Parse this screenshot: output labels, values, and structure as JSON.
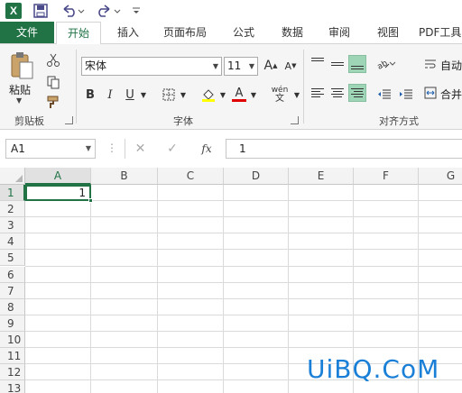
{
  "quick_access": {
    "excel_logo": "X"
  },
  "tabs": [
    "文件",
    "开始",
    "插入",
    "页面布局",
    "公式",
    "数据",
    "审阅",
    "视图",
    "PDF工具"
  ],
  "ribbon": {
    "clipboard": {
      "paste_label": "粘贴",
      "group_label": "剪贴板"
    },
    "font": {
      "font_name": "宋体",
      "font_size": "11",
      "group_label": "字体",
      "bold": "B",
      "italic": "I",
      "underline": "U",
      "grow": "A",
      "shrink": "A",
      "phonetic": "wén",
      "font_color_glyph": "A"
    },
    "alignment": {
      "group_label": "对齐方式",
      "wrap_text": "自动",
      "merge": "合并"
    }
  },
  "formula_bar": {
    "name_box": "A1",
    "fx_label": "fx",
    "content": "1"
  },
  "sheet": {
    "columns": [
      "A",
      "B",
      "C",
      "D",
      "E",
      "F",
      "G"
    ],
    "rows": [
      "1",
      "2",
      "3",
      "4",
      "5",
      "6",
      "7",
      "8",
      "9",
      "10",
      "11",
      "12",
      "13"
    ],
    "cell_a1": "1"
  },
  "watermark": "UiBQ.CoM",
  "colors": {
    "accent": "#217346",
    "selected_align": "#9fd5b7",
    "watermark": "#1a7fd6"
  }
}
